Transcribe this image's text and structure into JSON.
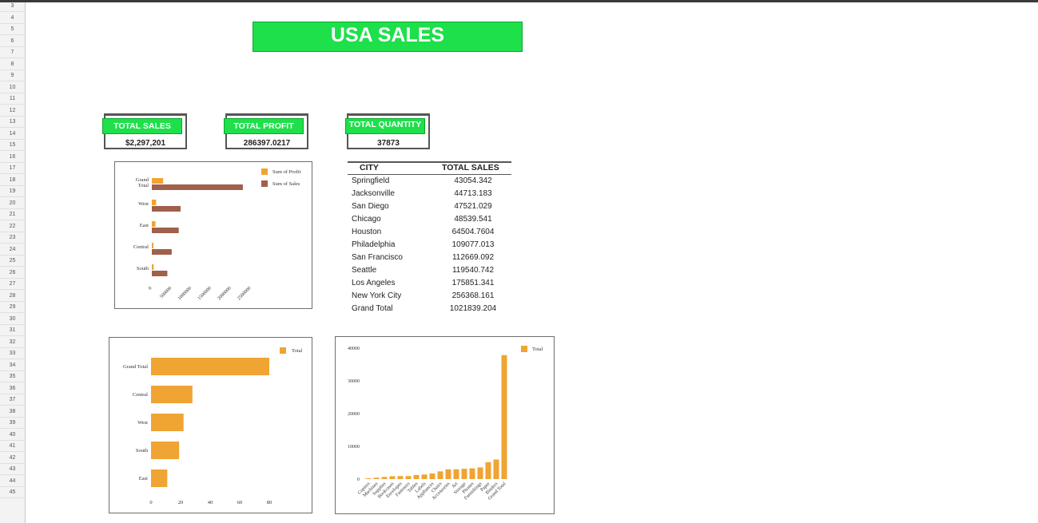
{
  "sheet": {
    "row_numbers": [
      "3",
      "4",
      "5",
      "6",
      "7",
      "8",
      "9",
      "10",
      "11",
      "12",
      "13",
      "14",
      "15",
      "16",
      "17",
      "18",
      "19",
      "20",
      "21",
      "22",
      "23",
      "24",
      "25",
      "26",
      "27",
      "28",
      "29",
      "30",
      "31",
      "32",
      "33",
      "34",
      "35",
      "36",
      "37",
      "38",
      "39",
      "40",
      "41",
      "42",
      "43",
      "44",
      "45"
    ]
  },
  "title": "USA SALES",
  "kpis": [
    {
      "label": "TOTAL SALES",
      "value": "$2,297,201"
    },
    {
      "label": "TOTAL PROFIT",
      "value": "286397.0217"
    },
    {
      "label": "TOTAL QUANTITY",
      "value": "37873"
    }
  ],
  "city_table": {
    "headers": [
      "CITY",
      "TOTAL SALES"
    ],
    "rows": [
      [
        "Springfield",
        "43054.342"
      ],
      [
        "Jacksonville",
        "44713.183"
      ],
      [
        "San Diego",
        "47521.029"
      ],
      [
        "Chicago",
        "48539.541"
      ],
      [
        "Houston",
        "64504.7604"
      ],
      [
        "Philadelphia",
        "109077.013"
      ],
      [
        "San Francisco",
        "112669.092"
      ],
      [
        "Seattle",
        "119540.742"
      ],
      [
        "Los Angeles",
        "175851.341"
      ],
      [
        "New York City",
        "256368.161"
      ],
      [
        "Grand Total",
        "1021839.204"
      ]
    ]
  },
  "colors": {
    "orange": "#f0a433",
    "brown": "#a0604a",
    "green": "#1ee04a"
  },
  "chart_data": [
    {
      "type": "bar",
      "orientation": "horizontal",
      "categories": [
        "Grand Total",
        "West",
        "East",
        "Central",
        "South"
      ],
      "series": [
        {
          "name": "Sum of Profit",
          "values": [
            286397,
            108418,
            91523,
            39706,
            46749
          ]
        },
        {
          "name": "Sum of Sales",
          "values": [
            2297201,
            725458,
            678781,
            501240,
            391722
          ]
        }
      ],
      "xticks": [
        "0",
        "500000",
        "1000000",
        "1500000",
        "2000000",
        "2500000"
      ],
      "xlim": [
        0,
        2500000
      ],
      "legend": "top-right"
    },
    {
      "type": "bar",
      "orientation": "horizontal",
      "categories": [
        "Grand Total",
        "Central",
        "West",
        "South",
        "East"
      ],
      "series": [
        {
          "name": "Total",
          "values": [
            80,
            28,
            22,
            19,
            11
          ]
        }
      ],
      "xticks": [
        "0",
        "20",
        "40",
        "60",
        "80"
      ],
      "xlim": [
        0,
        80
      ],
      "legend": "top-right"
    },
    {
      "type": "bar",
      "orientation": "vertical",
      "categories": [
        "Copiers",
        "Machines",
        "Supplies",
        "Bookcases",
        "Envelopes",
        "Fasteners",
        "Tables",
        "Labels",
        "Appliances",
        "Chairs",
        "Accessories",
        "Art",
        "Storage",
        "Phones",
        "Furnishings",
        "Paper",
        "Binders",
        "Grand Total"
      ],
      "series": [
        {
          "name": "Total",
          "values": [
            234,
            440,
            647,
            868,
            906,
            914,
            1241,
            1400,
            1729,
            2356,
            2976,
            3000,
            3158,
            3289,
            3563,
            5178,
            5974,
            37873
          ]
        }
      ],
      "yticks": [
        "0",
        "10000",
        "20000",
        "30000",
        "40000"
      ],
      "ylim": [
        0,
        40000
      ],
      "legend": "top-right"
    }
  ]
}
